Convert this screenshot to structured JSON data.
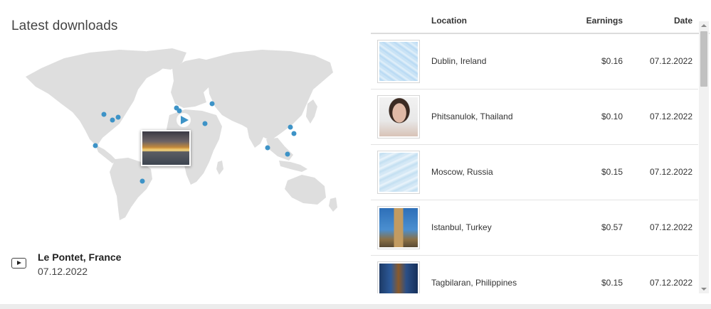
{
  "section": {
    "title": "Latest downloads"
  },
  "map": {
    "land_color": "#dedede",
    "dot_color": "#3d93c7",
    "play_marker_icon": "play-triangle-icon",
    "thumbnail_icon": "sunset-photo"
  },
  "now_playing": {
    "location": "Le Pontet, France",
    "date": "07.12.2022",
    "play_icon": "play-button-icon"
  },
  "table": {
    "headers": {
      "location": "Location",
      "earnings": "Earnings",
      "date": "Date"
    },
    "rows": [
      {
        "location": "Dublin, Ireland",
        "earnings": "$0.16",
        "date": "07.12.2022",
        "thumb": "ice-texture"
      },
      {
        "location": "Phitsanulok, Thailand",
        "earnings": "$0.10",
        "date": "07.12.2022",
        "thumb": "woman-portrait"
      },
      {
        "location": "Moscow, Russia",
        "earnings": "$0.15",
        "date": "07.12.2022",
        "thumb": "ice-texture"
      },
      {
        "location": "Istanbul, Turkey",
        "earnings": "$0.57",
        "date": "07.12.2022",
        "thumb": "clock-tower"
      },
      {
        "location": "Tagbilaran, Philippines",
        "earnings": "$0.15",
        "date": "07.12.2022",
        "thumb": "boat-interior"
      }
    ]
  },
  "colors": {
    "accent": "#3d93c7",
    "divider": "#e3e3e3"
  }
}
